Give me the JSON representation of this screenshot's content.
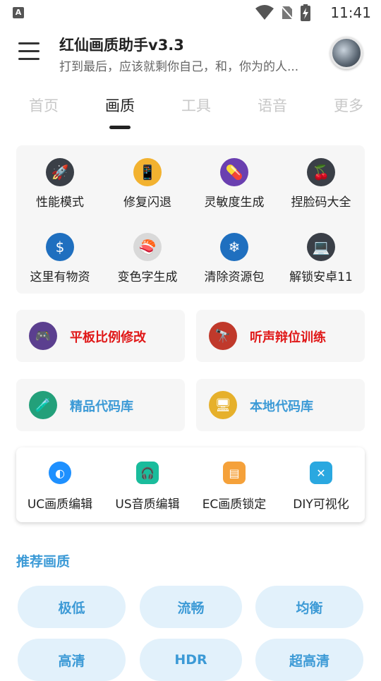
{
  "status_bar": {
    "time": "11:41",
    "notification_letter": "A"
  },
  "header": {
    "title": "红仙画质助手v3.3",
    "subtitle": "打到最后，应该就剩你自己，和，你为的人..."
  },
  "tabs": [
    {
      "label": "首页"
    },
    {
      "label": "画质"
    },
    {
      "label": "工具"
    },
    {
      "label": "语音"
    },
    {
      "label": "更多"
    }
  ],
  "tools_grid": [
    {
      "label": "性能模式",
      "icon": "rocket-icon",
      "color": "#3a3f47"
    },
    {
      "label": "修复闪退",
      "icon": "phone-repair-icon",
      "color": "#f2b230"
    },
    {
      "label": "灵敏度生成",
      "icon": "pills-icon",
      "color": "#6a3fb0"
    },
    {
      "label": "捏脸码大全",
      "icon": "cherry-icon",
      "color": "#3a3f47"
    },
    {
      "label": "这里有物资",
      "icon": "money-magnet-icon",
      "color": "#1f6fbf"
    },
    {
      "label": "变色字生成",
      "icon": "sushi-icon",
      "color": "#d9d9d9"
    },
    {
      "label": "清除资源包",
      "icon": "snowflake-icon",
      "color": "#1f6fbf"
    },
    {
      "label": "解锁安卓11",
      "icon": "laptop-icon",
      "color": "#3a3f47"
    }
  ],
  "wide_buttons": [
    {
      "label": "平板比例修改",
      "icon": "gameboy-icon",
      "color": "#5b3f8f",
      "style": "red"
    },
    {
      "label": "听声辩位训练",
      "icon": "telescope-icon",
      "color": "#c0392b",
      "style": "red"
    },
    {
      "label": "精品代码库",
      "icon": "test-tube-icon",
      "color": "#23a07a",
      "style": "blue"
    },
    {
      "label": "本地代码库",
      "icon": "monitor-icon",
      "color": "#e6b02b",
      "style": "blue"
    }
  ],
  "quick_tools": [
    {
      "label": "UC画质编辑",
      "icon": "circle-app-icon",
      "color": "#1e90ff"
    },
    {
      "label": "US音质编辑",
      "icon": "headphone-icon",
      "color": "#1abc9c"
    },
    {
      "label": "EC画质锁定",
      "icon": "document-icon",
      "color": "#f5a13a"
    },
    {
      "label": "DIY可视化",
      "icon": "x-shape-icon",
      "color": "#2aa8e0"
    }
  ],
  "recommended": {
    "title": "推荐画质",
    "options": [
      "极低",
      "流畅",
      "均衡",
      "高清",
      "HDR",
      "超高清"
    ]
  },
  "colors": {
    "accent": "#3c9ad6",
    "warning": "#e01818",
    "pill_bg": "#e2f1fb"
  }
}
